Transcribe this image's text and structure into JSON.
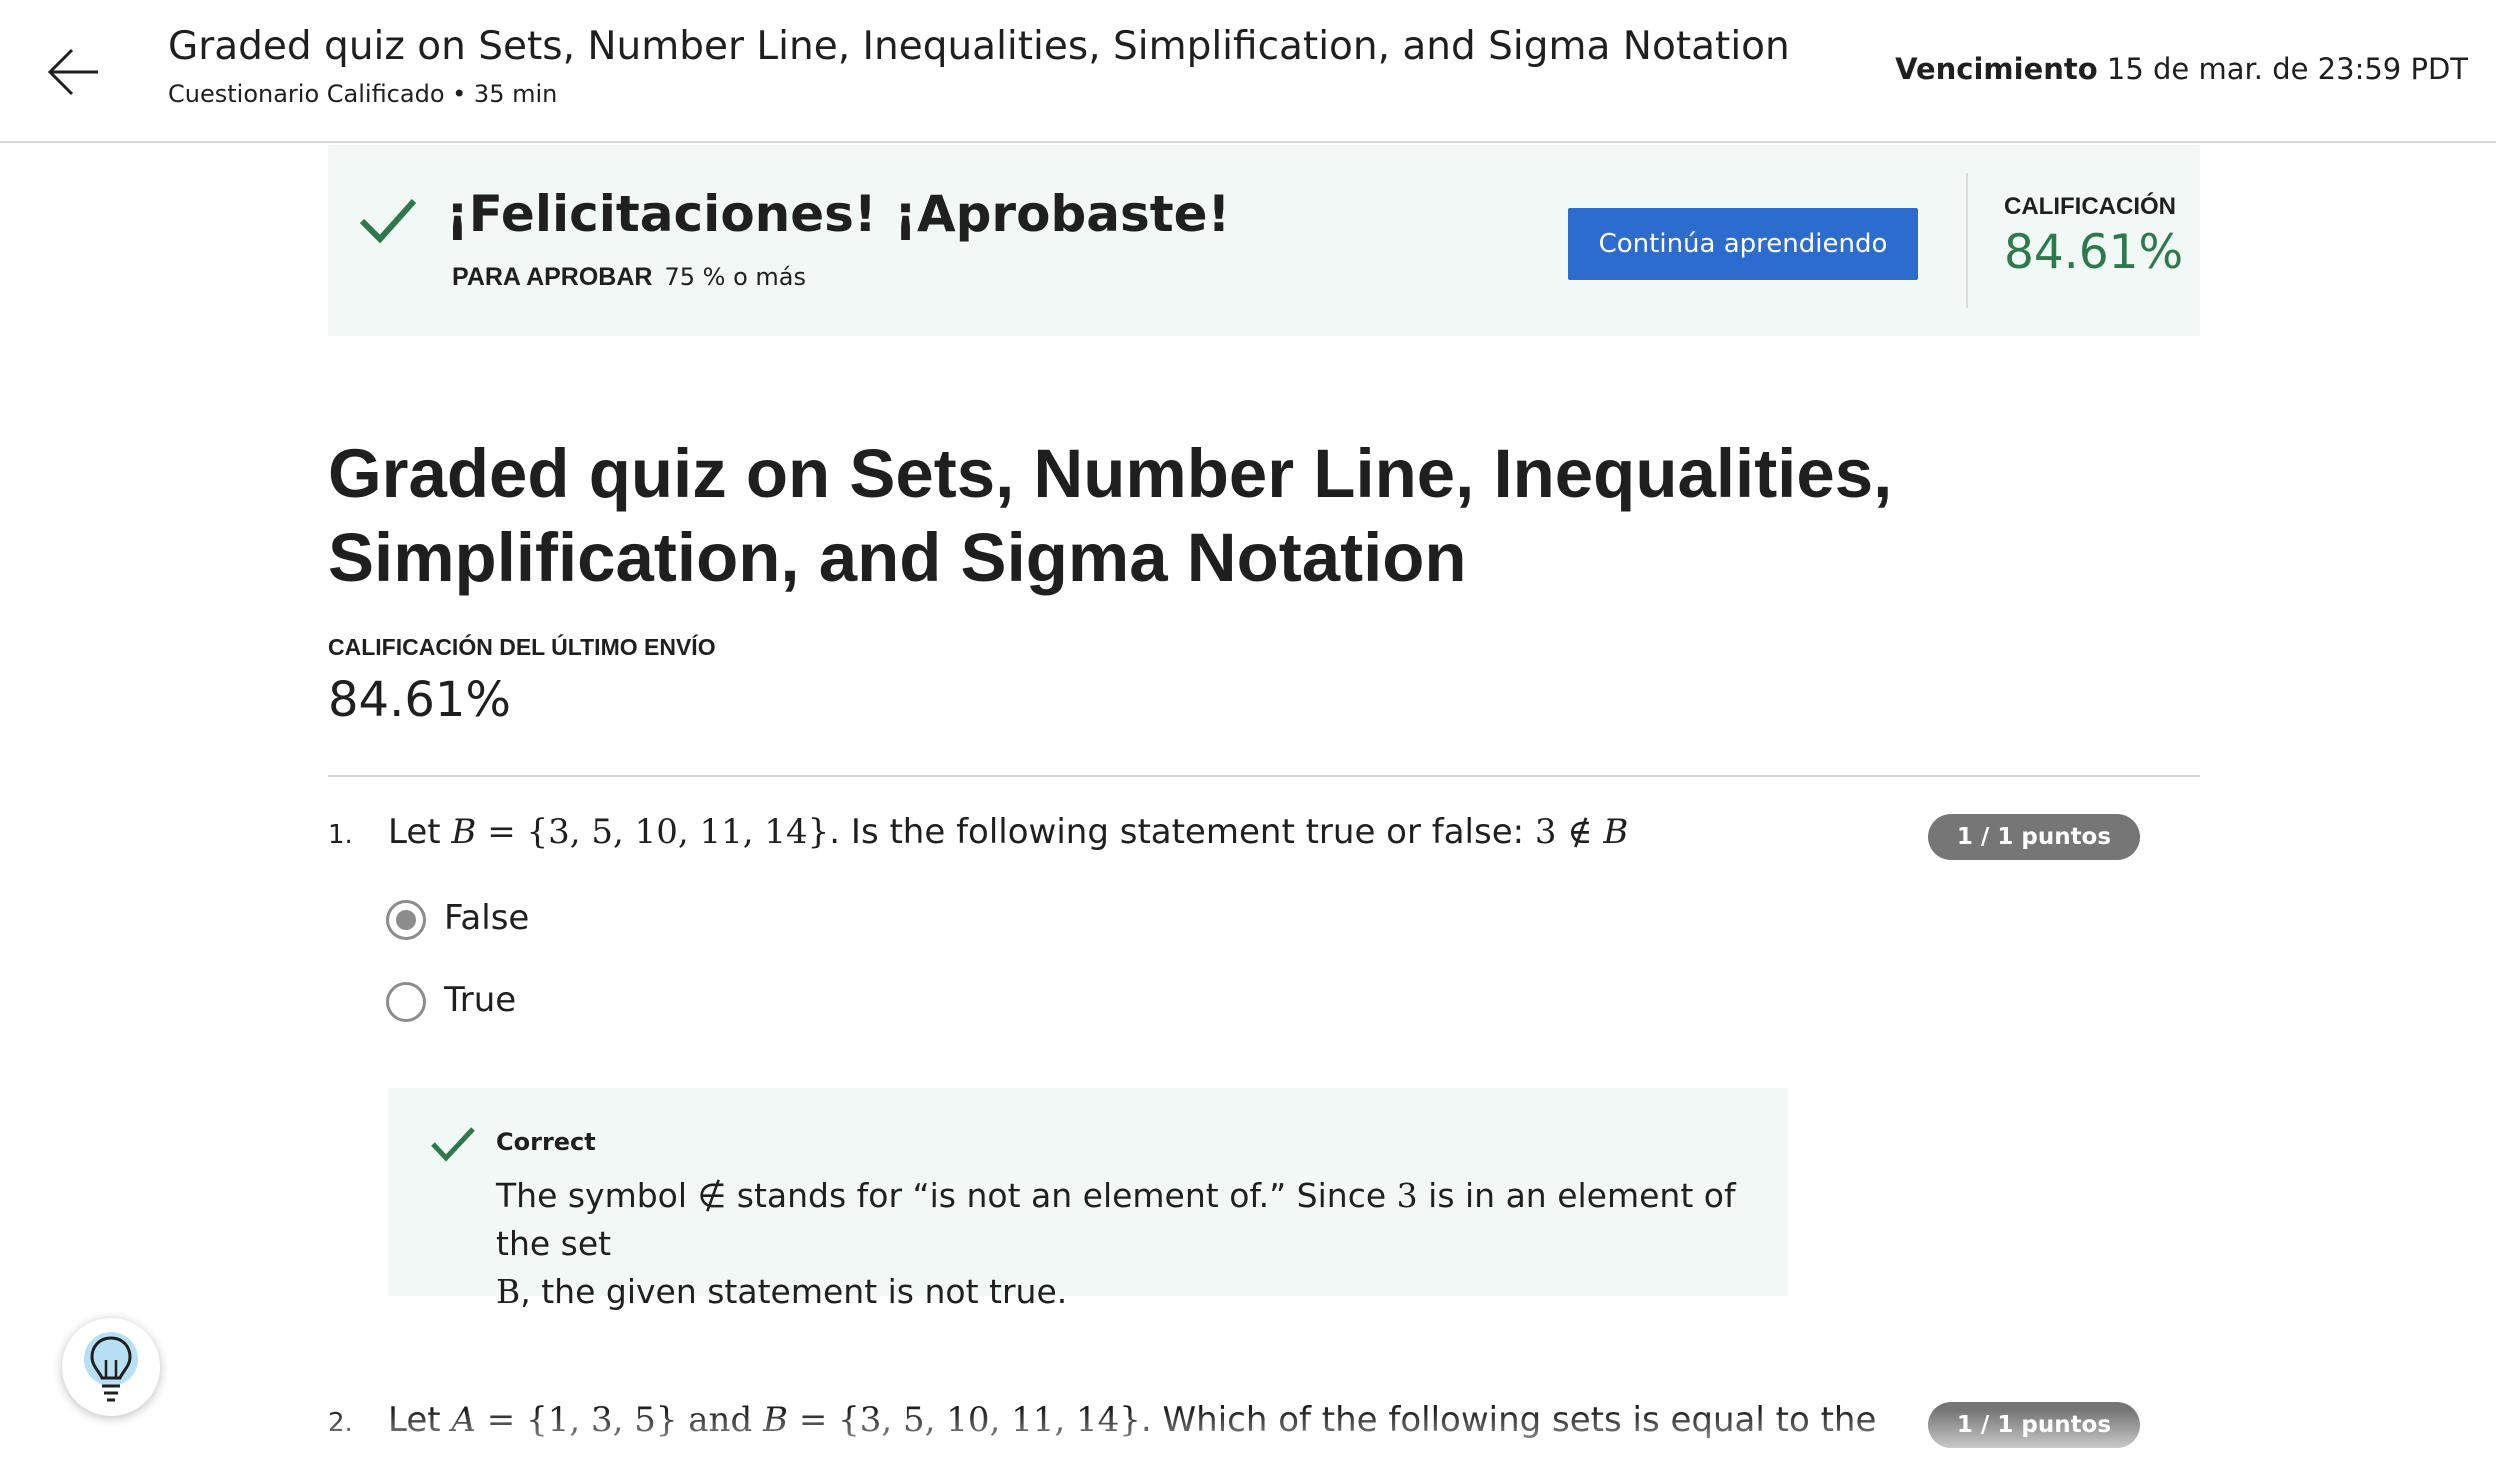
{
  "header": {
    "title": "Graded quiz on Sets, Number Line, Inequalities, Simplification, and Sigma Notation",
    "subtitle": "Cuestionario Calificado • 35 min",
    "due_label": "Vencimiento",
    "due_value": "15 de mar. de 23:59 PDT",
    "back_icon": "arrow-left-icon"
  },
  "banner": {
    "title": "¡Felicitaciones! ¡Aprobaste!",
    "pass_label": "PARA APROBAR",
    "pass_value": "75 % o más",
    "continue_label": "Continúa aprendiendo",
    "grade_label": "CALIFICACIÓN",
    "grade_value": "84.61%",
    "accent_color": "#2c7a4b",
    "button_color": "#2d6ccf"
  },
  "main": {
    "title": "Graded quiz on Sets, Number Line, Inequalities, Simplification, and Sigma Notation",
    "last_submission_label": "CALIFICACIÓN DEL ÚLTIMO ENVÍO",
    "last_submission_value": "84.61%"
  },
  "questions": [
    {
      "number": "1.",
      "text_prefix": "Let ",
      "math_set_name": "B",
      "math_set_def": " = {3, 5, 10, 11, 14}",
      "text_middle": ". Is the following statement true or false: ",
      "math_statement": "3 ∉ ",
      "math_statement_var": "B",
      "points": "1 / 1 puntos",
      "options": [
        {
          "label": "False",
          "selected": true
        },
        {
          "label": "True",
          "selected": false
        }
      ],
      "feedback": {
        "title": "Correct",
        "text_part1": "The symbol ∉ stands for “is not an element of.” Since ",
        "math_3": "3",
        "text_part2": " is in an element of the set",
        "math_B": "B",
        "text_part3": ", the given statement is not true."
      }
    },
    {
      "number": "2.",
      "text_prefix": "Let ",
      "math_a": "A",
      "math_a_def": " = {1, 3, 5}",
      "text_and": " and ",
      "math_b": "B",
      "math_b_def": " = {3, 5, 10, 11, 14}",
      "text_rest": ". Which of the following sets is equal to the",
      "points": "1 / 1 puntos"
    }
  ],
  "help": {
    "icon": "lightbulb-icon"
  }
}
